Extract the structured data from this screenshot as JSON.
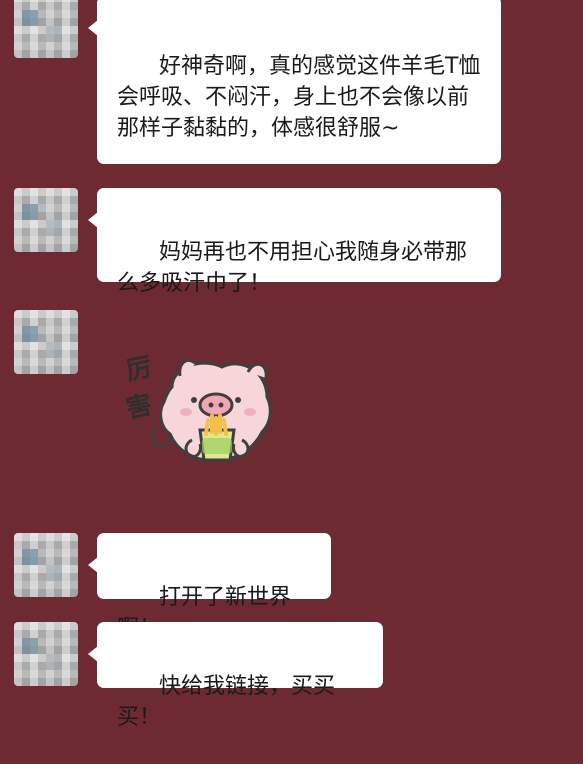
{
  "messages": [
    {
      "type": "text",
      "text": "好神奇啊，真的感觉这件羊毛T恤会呼吸、不闷汗，身上也不会像以前那样子黏黏的，体感很舒服~"
    },
    {
      "type": "text",
      "text": "妈妈再也不用担心我随身必带那么多吸汗巾了！"
    },
    {
      "type": "sticker",
      "sticker_text": "厉害",
      "sticker_name": "pig-sticker-icon"
    },
    {
      "type": "text",
      "text": "打开了新世界啊！"
    },
    {
      "type": "text",
      "text": "快给我链接，买买买！"
    }
  ],
  "colors": {
    "background": "#6e2a33",
    "bubble": "#ffffff",
    "text": "#1a1a1a",
    "pig_body": "#f7d6da",
    "pig_snout": "#f1a6b3"
  }
}
